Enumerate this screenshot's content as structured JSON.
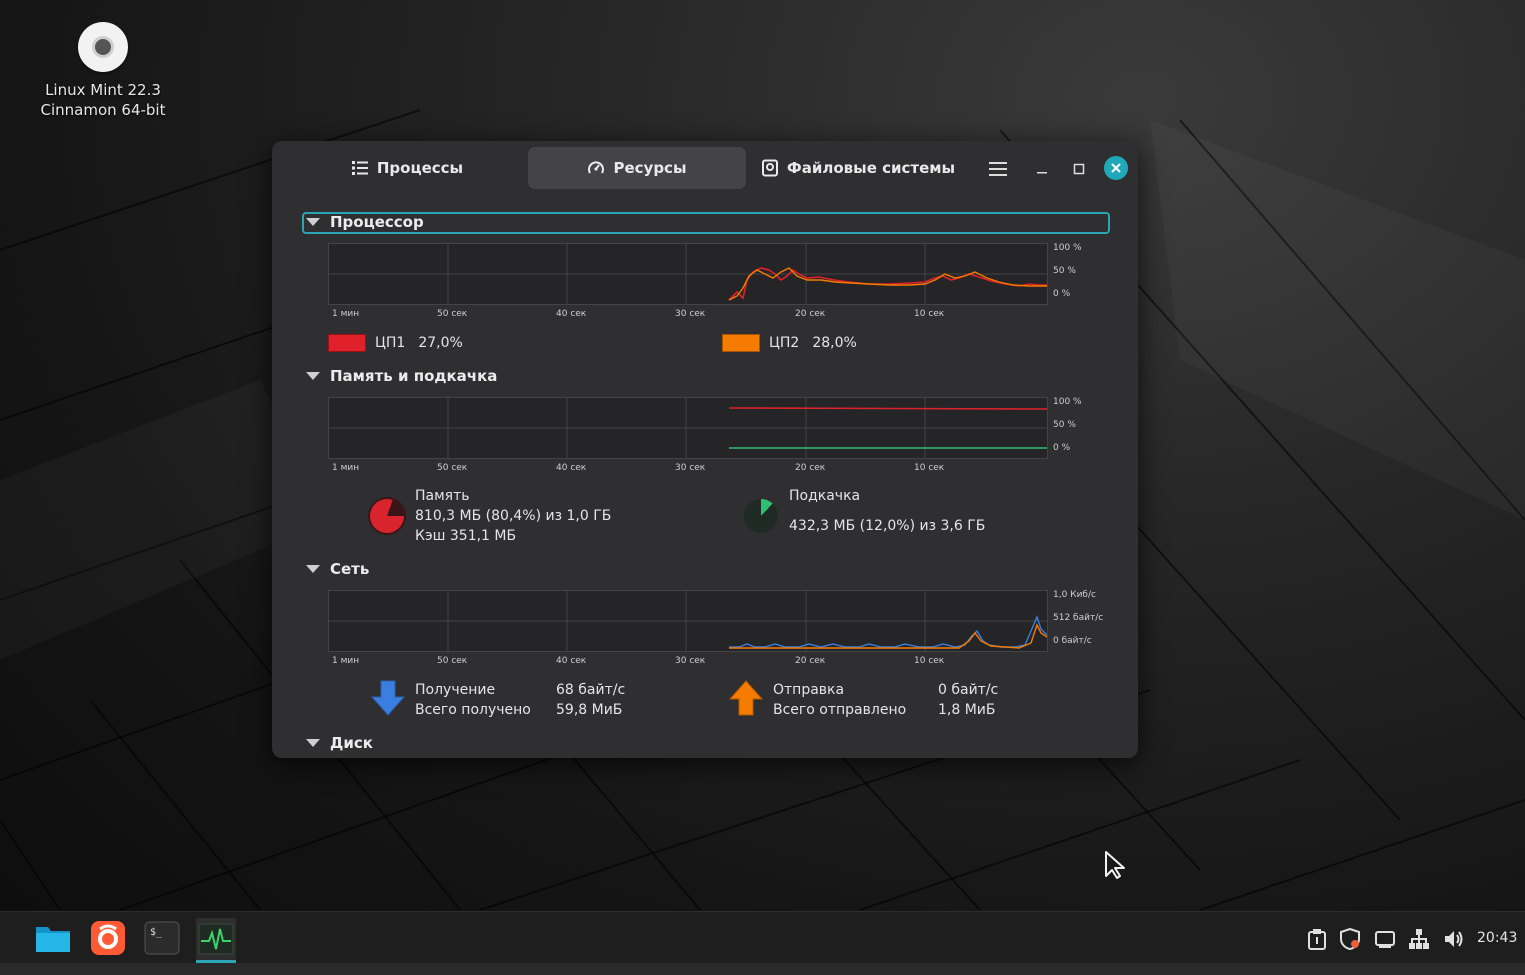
{
  "desktop": {
    "icon_label_line1": "Linux Mint 22.3",
    "icon_label_line2": "Cinnamon 64-bit"
  },
  "window": {
    "tabs": [
      {
        "label": "Процессы",
        "icon": "list-icon"
      },
      {
        "label": "Ресурсы",
        "icon": "gauge-icon",
        "active": true
      },
      {
        "label": "Файловые системы",
        "icon": "disk-icon"
      }
    ],
    "sections": {
      "cpu": "Процессор",
      "memory": "Память и подкачка",
      "network": "Сеть",
      "disk": "Диск"
    },
    "time_ticks": [
      "1 мин",
      "50 сек",
      "40 сек",
      "30 сек",
      "20 сек",
      "10 сек"
    ],
    "percent_ticks": [
      "100 %",
      "50 %",
      "0 %"
    ],
    "net_ticks": [
      "1,0 Киб/с",
      "512 байт/с",
      "0 байт/с"
    ],
    "cpu": {
      "cpu1_label": "ЦП1",
      "cpu1_value": "27,0%",
      "cpu1_color": "#e0202a",
      "cpu2_label": "ЦП2",
      "cpu2_value": "28,0%",
      "cpu2_color": "#f57c00"
    },
    "memory": {
      "mem_title": "Память",
      "mem_value": "810,3 МБ (80,4%) из 1,0 ГБ",
      "mem_cache": "Кэш 351,1 МБ",
      "mem_percent": 80.4,
      "swap_title": "Подкачка",
      "swap_value": "432,3 МБ (12,0%) из 3,6 ГБ",
      "swap_percent": 12.0,
      "mem_color": "#d9232d",
      "swap_color": "#2fbf71"
    },
    "network": {
      "recv_label": "Получение",
      "recv_rate": "68 байт/с",
      "recv_total_label": "Всего получено",
      "recv_total": "59,8 МиБ",
      "send_label": "Отправка",
      "send_rate": "0 байт/с",
      "send_total_label": "Всего отправлено",
      "send_total": "1,8 МиБ",
      "recv_color": "#3a7fe0",
      "send_color": "#f57c00"
    }
  },
  "taskbar": {
    "clock": "20:43"
  }
}
